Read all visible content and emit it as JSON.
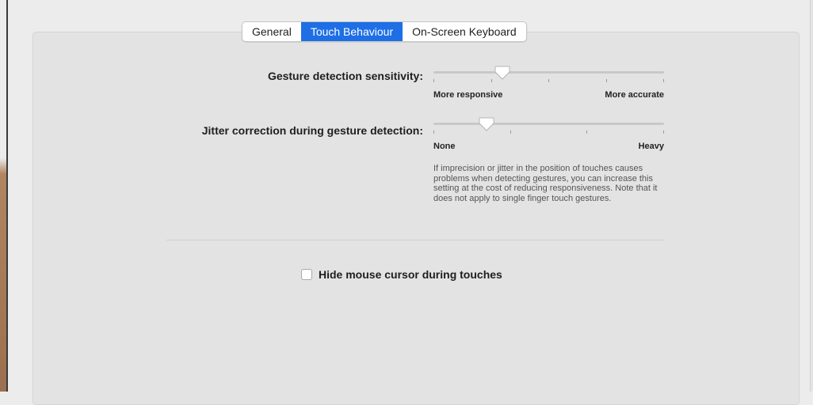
{
  "tabs": [
    {
      "label": "General",
      "selected": false
    },
    {
      "label": "Touch Behaviour",
      "selected": true
    },
    {
      "label": "On-Screen Keyboard",
      "selected": false
    }
  ],
  "gesture_sensitivity": {
    "label": "Gesture detection sensitivity:",
    "min_label": "More responsive",
    "max_label": "More accurate",
    "value": 0.3,
    "tick_count": 5
  },
  "jitter_correction": {
    "label": "Jitter correction during gesture detection:",
    "min_label": "None",
    "max_label": "Heavy",
    "value": 0.23,
    "tick_count": 4,
    "help_text": "If imprecision or jitter in the position of touches causes problems when detecting gestures, you can increase this setting at the cost of reducing responsiveness. Note that it does not apply to single finger touch gestures."
  },
  "hide_cursor": {
    "label": "Hide mouse cursor during touches",
    "checked": false
  },
  "colors": {
    "accent": "#1e6fe6",
    "panel": "#e3e3e3",
    "window": "#ececec"
  }
}
